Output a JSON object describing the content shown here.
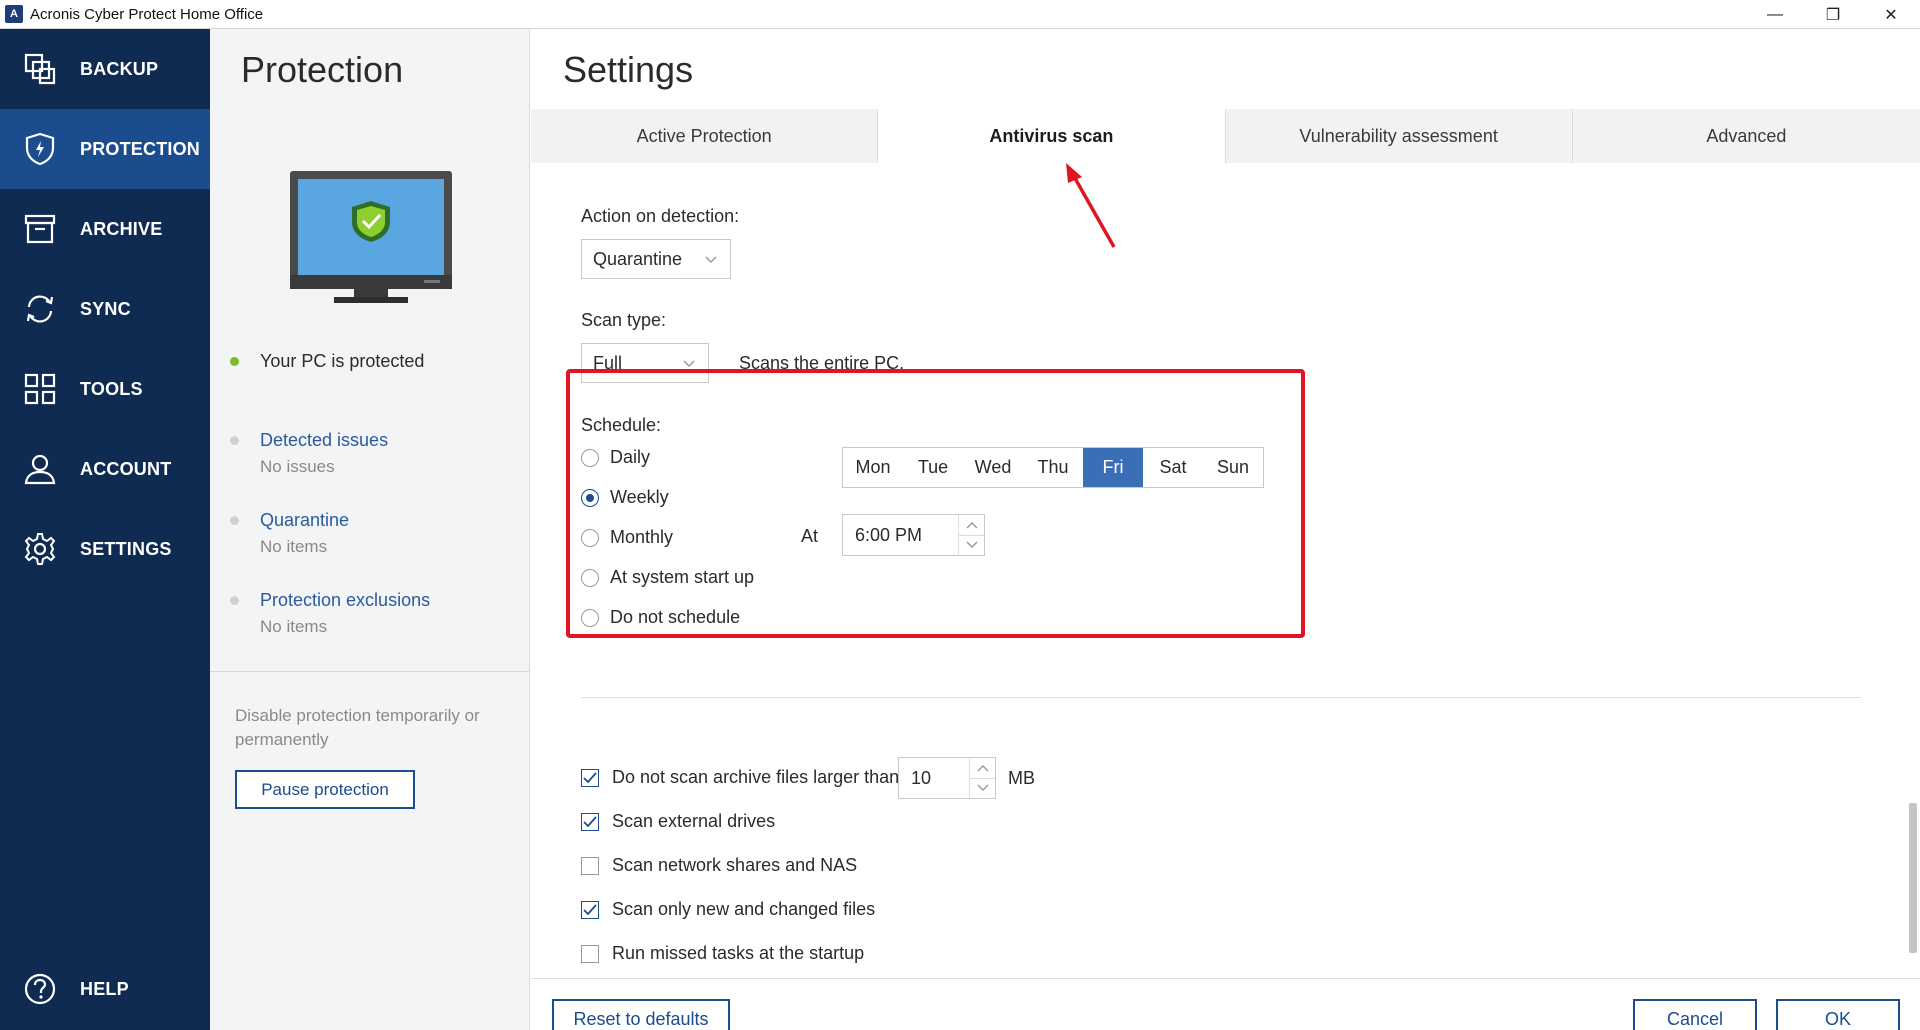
{
  "window": {
    "title": "Acronis Cyber Protect Home Office",
    "app_icon_letter": "A",
    "minimize": "—",
    "restore": "❐",
    "close": "✕"
  },
  "nav": {
    "items": [
      {
        "label": "BACKUP",
        "icon": "backup-icon"
      },
      {
        "label": "PROTECTION",
        "icon": "shield-icon"
      },
      {
        "label": "ARCHIVE",
        "icon": "archive-icon"
      },
      {
        "label": "SYNC",
        "icon": "sync-icon"
      },
      {
        "label": "TOOLS",
        "icon": "tools-icon"
      },
      {
        "label": "ACCOUNT",
        "icon": "account-icon"
      },
      {
        "label": "SETTINGS",
        "icon": "gear-icon"
      }
    ],
    "help_label": "HELP"
  },
  "protection_panel": {
    "title": "Protection",
    "status": "Your PC is protected",
    "detected_issues": {
      "label": "Detected issues",
      "value": "No issues"
    },
    "quarantine": {
      "label": "Quarantine",
      "value": "No items"
    },
    "exclusions": {
      "label": "Protection exclusions",
      "value": "No items"
    },
    "disable_text": "Disable protection temporarily or permanently",
    "pause_button": "Pause protection"
  },
  "settings": {
    "title": "Settings",
    "tabs": [
      {
        "label": "Active Protection",
        "active": false
      },
      {
        "label": "Antivirus scan",
        "active": true
      },
      {
        "label": "Vulnerability assessment",
        "active": false
      },
      {
        "label": "Advanced",
        "active": false
      }
    ],
    "action_on_detection": {
      "label": "Action on detection:",
      "value": "Quarantine"
    },
    "scan_type": {
      "label": "Scan type:",
      "value": "Full",
      "description": "Scans the entire PC."
    },
    "schedule": {
      "label": "Schedule:",
      "options": [
        {
          "label": "Daily",
          "checked": false
        },
        {
          "label": "Weekly",
          "checked": true
        },
        {
          "label": "Monthly",
          "checked": false
        },
        {
          "label": "At system start up",
          "checked": false
        },
        {
          "label": "Do not schedule",
          "checked": false
        }
      ],
      "days": [
        {
          "label": "Mon",
          "selected": false
        },
        {
          "label": "Tue",
          "selected": false
        },
        {
          "label": "Wed",
          "selected": false
        },
        {
          "label": "Thu",
          "selected": false
        },
        {
          "label": "Fri",
          "selected": true
        },
        {
          "label": "Sat",
          "selected": false
        },
        {
          "label": "Sun",
          "selected": false
        }
      ],
      "at_label": "At",
      "time": "6:00 PM"
    },
    "options": {
      "archive_limit": {
        "label": "Do not scan archive files larger than",
        "checked": true,
        "value": "10",
        "unit": "MB"
      },
      "external_drives": {
        "label": "Scan external drives",
        "checked": true
      },
      "network_shares": {
        "label": "Scan network shares and NAS",
        "checked": false
      },
      "new_changed": {
        "label": "Scan only new and changed files",
        "checked": true
      },
      "missed_tasks": {
        "label": "Run missed tasks at the startup",
        "checked": false
      }
    },
    "footer": {
      "reset": "Reset to defaults",
      "cancel": "Cancel",
      "ok": "OK"
    }
  },
  "colors": {
    "nav_bg": "#0f2b52",
    "nav_active": "#1a4c8e",
    "accent": "#1a4c8e",
    "highlight_box": "#e1151f",
    "status_green": "#7dbb2b",
    "selected_day": "#3a6fb5"
  }
}
